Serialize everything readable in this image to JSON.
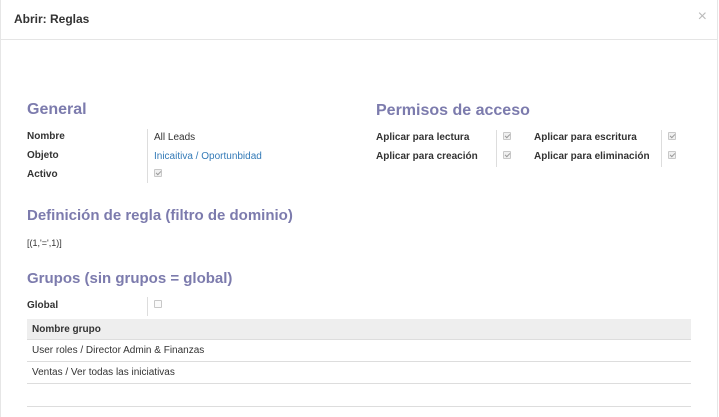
{
  "dialog": {
    "title": "Abrir: Reglas",
    "close_glyph": "×"
  },
  "general": {
    "title": "General",
    "fields": {
      "name_label": "Nombre",
      "name_value": "All Leads",
      "object_label": "Objeto",
      "object_value": "Inicaitiva / Oportunbidad",
      "active_label": "Activo",
      "active_checked": true
    }
  },
  "permissions": {
    "title": "Permisos de acceso",
    "read_label": "Aplicar para lectura",
    "read_checked": true,
    "create_label": "Aplicar para creación",
    "create_checked": true,
    "write_label": "Aplicar para escritura",
    "write_checked": true,
    "unlink_label": "Aplicar para eliminación",
    "unlink_checked": true
  },
  "domain": {
    "title": "Definición de regla (filtro de dominio)",
    "value": "[(1,'=',1)]"
  },
  "groups": {
    "title": "Grupos (sin grupos = global)",
    "global_label": "Global",
    "global_checked": false,
    "column_header": "Nombre grupo",
    "rows": [
      "User roles / Director Admin & Finanzas",
      "Ventas / Ver todas las iniciativas"
    ]
  },
  "colors": {
    "section_title": "#7c7bad",
    "link": "#337ab7"
  }
}
